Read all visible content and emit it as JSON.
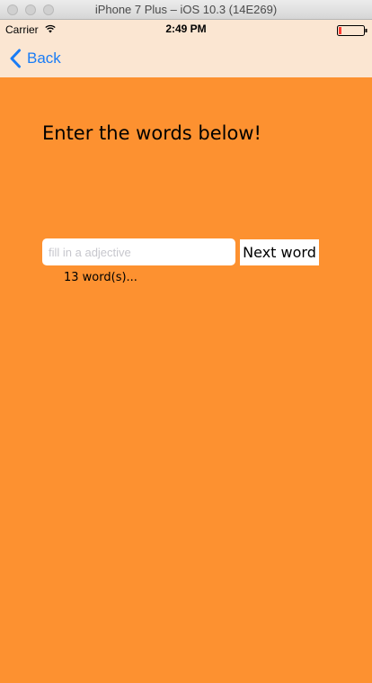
{
  "window": {
    "title": "iPhone 7 Plus – iOS 10.3 (14E269)"
  },
  "status_bar": {
    "carrier": "Carrier",
    "time": "2:49 PM",
    "wifi_icon": "wifi-icon",
    "battery_icon": "battery-icon"
  },
  "nav": {
    "back_label": "Back",
    "back_icon": "chevron-left-icon"
  },
  "main": {
    "heading": "Enter the words below!",
    "input_placeholder": "fill in a adjective",
    "input_value": "",
    "next_button_label": "Next word",
    "word_count_text": "13 word(s)..."
  },
  "colors": {
    "background": "#fd9130",
    "nav_background": "#fbe6d2",
    "accent": "#1a7cf5"
  }
}
